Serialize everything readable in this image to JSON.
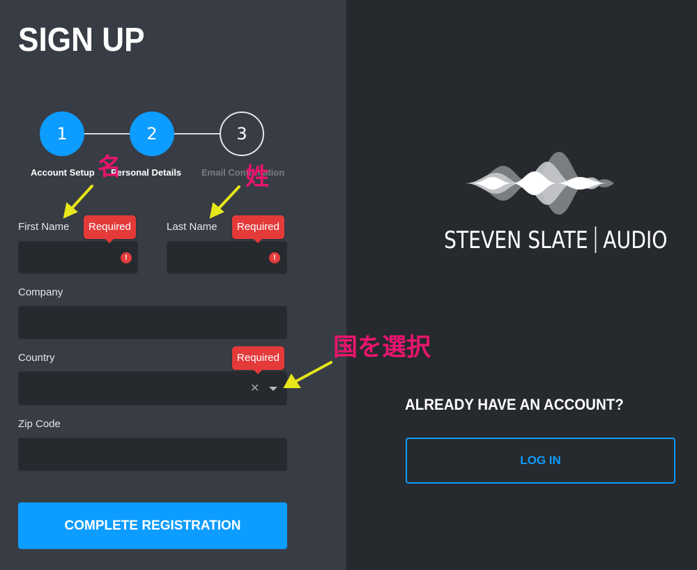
{
  "page": {
    "title": "SIGN UP"
  },
  "steps": [
    {
      "number": "1",
      "label": "Account Setup",
      "state": "complete"
    },
    {
      "number": "2",
      "label": "Personal Details",
      "state": "active"
    },
    {
      "number": "3",
      "label": "Email Confirmation",
      "state": "pending"
    }
  ],
  "form": {
    "first_name": {
      "label": "First Name",
      "value": "",
      "error": "Required"
    },
    "last_name": {
      "label": "Last Name",
      "value": "",
      "error": "Required"
    },
    "company": {
      "label": "Company",
      "value": ""
    },
    "country": {
      "label": "Country",
      "value": "",
      "error": "Required"
    },
    "zip_code": {
      "label": "Zip Code",
      "value": ""
    },
    "submit_label": "COMPLETE REGISTRATION"
  },
  "brand": {
    "name_left": "STEVEN SLATE",
    "name_right": "AUDIO"
  },
  "account": {
    "prompt": "ALREADY HAVE AN ACCOUNT?",
    "login_label": "LOG IN"
  },
  "annotations": {
    "first_name_note": "名",
    "last_name_note": "姓",
    "country_note": "国を選択"
  },
  "colors": {
    "accent": "#0d9cff",
    "error": "#e43a3a",
    "annotation": "#e8156e",
    "arrow": "#e6e61a"
  }
}
